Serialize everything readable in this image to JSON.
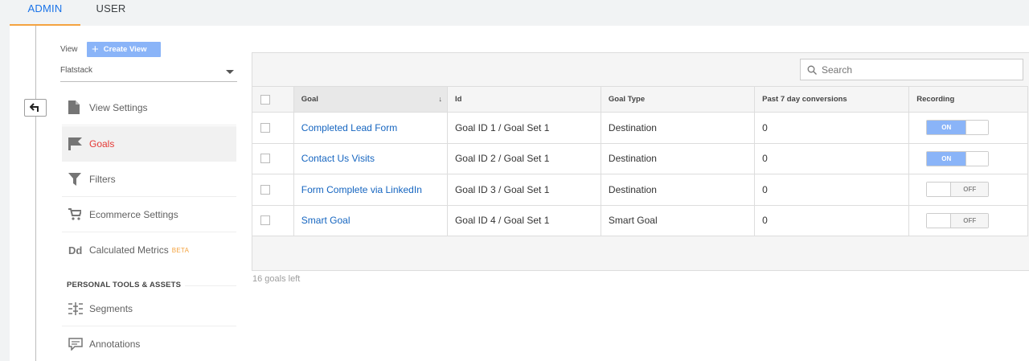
{
  "tabs": {
    "admin": "ADMIN",
    "user": "USER"
  },
  "view": {
    "label": "View",
    "create_label": "Create View",
    "selected": "Flatstack"
  },
  "nav": {
    "items": [
      {
        "label": "View Settings",
        "icon": "document-icon"
      },
      {
        "label": "Goals",
        "icon": "flag-icon"
      },
      {
        "label": "Filters",
        "icon": "filter-icon"
      },
      {
        "label": "Ecommerce Settings",
        "icon": "cart-icon"
      },
      {
        "label": "Calculated Metrics",
        "badge": "BETA",
        "icon": "dd-icon"
      },
      {
        "label": "Segments",
        "icon": "segments-icon"
      },
      {
        "label": "Annotations",
        "icon": "annotation-icon"
      }
    ],
    "heading": "PERSONAL TOOLS & ASSETS",
    "dd_glyph": "Dd"
  },
  "goals": {
    "search_placeholder": "Search",
    "columns": [
      "Goal",
      "Id",
      "Goal Type",
      "Past 7 day conversions",
      "Recording"
    ],
    "sort_arrow": "↓",
    "rows": [
      {
        "goal": "Completed Lead Form",
        "id": "Goal ID 1 / Goal Set 1",
        "type": "Destination",
        "conversions": "0",
        "recording": "ON"
      },
      {
        "goal": "Contact Us Visits",
        "id": "Goal ID 2 / Goal Set 1",
        "type": "Destination",
        "conversions": "0",
        "recording": "ON"
      },
      {
        "goal": "Form Complete via LinkedIn",
        "id": "Goal ID 3 / Goal Set 1",
        "type": "Destination",
        "conversions": "0",
        "recording": "OFF"
      },
      {
        "goal": "Smart Goal",
        "id": "Goal ID 4 / Goal Set 1",
        "type": "Smart Goal",
        "conversions": "0",
        "recording": "OFF"
      }
    ],
    "footer": "16 goals left"
  },
  "colors": {
    "accent": "#1a73e8",
    "active_nav": "#e53935",
    "toggle_on": "#8ab4f8",
    "tab_underline": "#f4a340"
  }
}
